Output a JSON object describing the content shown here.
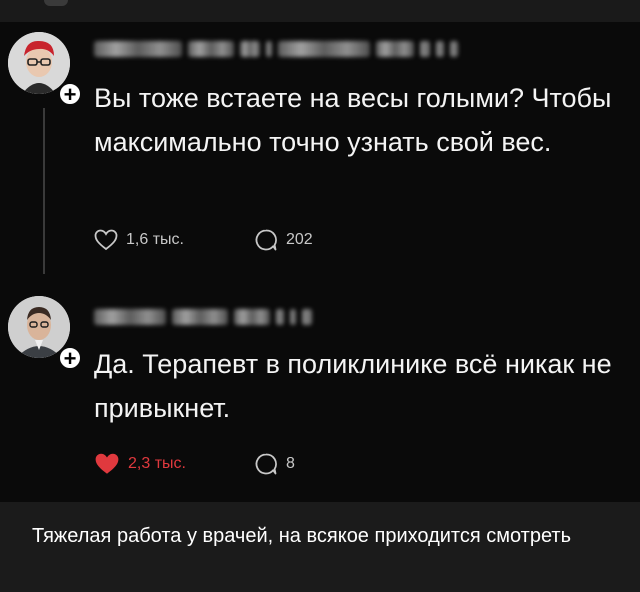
{
  "posts": [
    {
      "text": "Вы тоже встаете на весы голыми? Чтобы максимально точно узнать свой вес.",
      "likes": "1,6 тыс.",
      "comments": "202",
      "liked": false
    },
    {
      "text": "Да. Терапевт в поликлинике всё никак не привыкнет.",
      "likes": "2,3 тыс.",
      "comments": "8",
      "liked": true
    }
  ],
  "follow_badge": "+",
  "caption": "Тяжелая работа у врачей, на всякое приходится смотреть",
  "colors": {
    "background": "#0a0a0a",
    "caption_background": "#1b1b1b",
    "like_active": "#e0393e",
    "icon_inactive": "#c8c8c8"
  },
  "icons": [
    "heart-outline-icon",
    "comment-icon",
    "heart-filled-icon",
    "plus-icon"
  ]
}
